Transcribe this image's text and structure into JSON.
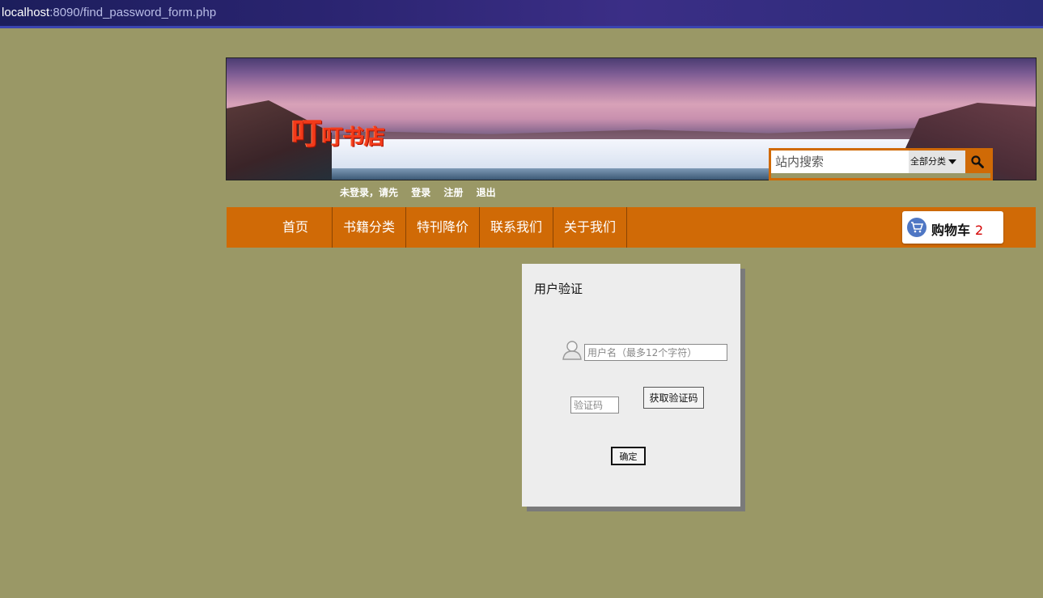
{
  "browser": {
    "url_host": "localhost",
    "url_rest": ":8090/find_password_form.php"
  },
  "header": {
    "logo_big": "叮",
    "logo_rest": "叮书店",
    "search": {
      "placeholder": "站内搜索",
      "category": "全部分类"
    },
    "login_line": {
      "prompt": "未登录，请先",
      "login": "登录",
      "register": "注册",
      "logout": "退出"
    }
  },
  "nav": {
    "items": [
      {
        "label": "首页"
      },
      {
        "label": "书籍分类"
      },
      {
        "label": "特刊降价"
      },
      {
        "label": "联系我们"
      },
      {
        "label": "关于我们"
      }
    ],
    "cart": {
      "label": "购物车",
      "count": "2"
    }
  },
  "verify_panel": {
    "title": "用户验证",
    "username_placeholder": "用户名（最多12个字符）",
    "code_placeholder": "验证码",
    "get_code_label": "获取验证码",
    "confirm_label": "确定"
  },
  "colors": {
    "page_bg": "#9a9866",
    "accent": "#d06a06",
    "cart_count": "#d40000"
  }
}
